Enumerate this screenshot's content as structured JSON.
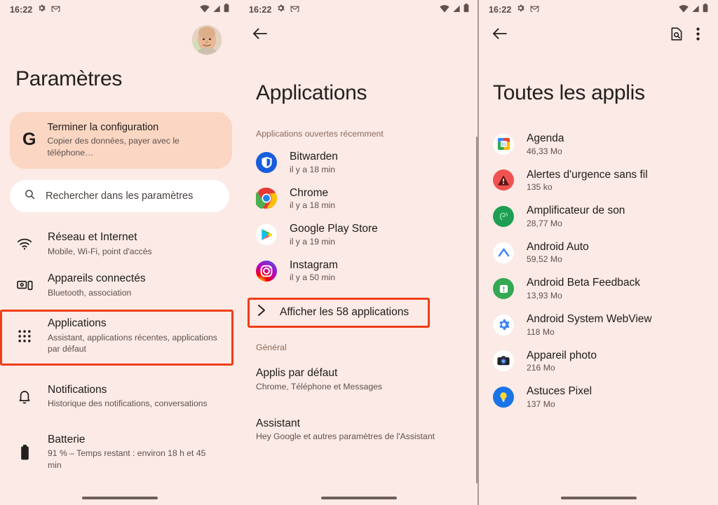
{
  "status_bar": {
    "time": "16:22",
    "left_icons": [
      "gear-icon",
      "gmail-icon"
    ],
    "right_icons": [
      "wifi-icon",
      "signal-icon",
      "battery-icon"
    ]
  },
  "colors": {
    "background": "#fbeae5",
    "setup_card": "#fbd6c2",
    "highlight": "#ef3e18",
    "text_primary": "#1e1b1a",
    "text_secondary": "#5d524f",
    "section_label": "#8c6a5d"
  },
  "screen1": {
    "title": "Paramètres",
    "avatar": "user-avatar",
    "setup_card": {
      "icon": "google-g-icon",
      "title": "Terminer la configuration",
      "subtitle": "Copier des données, payer avec le téléphone…"
    },
    "search": {
      "icon": "search-icon",
      "placeholder": "Rechercher dans les paramètres"
    },
    "items": [
      {
        "icon": "wifi-icon",
        "title": "Réseau et Internet",
        "subtitle": "Mobile, Wi-Fi, point d'accès",
        "highlighted": false
      },
      {
        "icon": "connected-devices-icon",
        "title": "Appareils connectés",
        "subtitle": "Bluetooth, association",
        "highlighted": false
      },
      {
        "icon": "apps-grid-icon",
        "title": "Applications",
        "subtitle": "Assistant, applications récentes, applications par défaut",
        "highlighted": true
      },
      {
        "icon": "bell-icon",
        "title": "Notifications",
        "subtitle": "Historique des notifications, conversations",
        "highlighted": false
      },
      {
        "icon": "battery-icon",
        "title": "Batterie",
        "subtitle": "91 % – Temps restant : environ 18 h et 45 min",
        "highlighted": false
      }
    ]
  },
  "screen2": {
    "back_icon": "back-arrow-icon",
    "title": "Applications",
    "recent_label": "Applications ouvertes récemment",
    "recent_apps": [
      {
        "icon": "bitwarden-icon",
        "name": "Bitwarden",
        "time": "il y a 18 min"
      },
      {
        "icon": "chrome-icon",
        "name": "Chrome",
        "time": "il y a 18 min"
      },
      {
        "icon": "play-store-icon",
        "name": "Google Play Store",
        "time": "il y a 19 min"
      },
      {
        "icon": "instagram-icon",
        "name": "Instagram",
        "time": "il y a 50 min"
      }
    ],
    "show_all": {
      "icon": "chevron-right-icon",
      "label": "Afficher les 58 applications",
      "highlighted": true
    },
    "general_label": "Général",
    "general_items": [
      {
        "title": "Applis par défaut",
        "subtitle": "Chrome, Téléphone et Messages"
      },
      {
        "title": "Assistant",
        "subtitle": "Hey Google et autres paramètres de l'Assistant"
      }
    ]
  },
  "screen3": {
    "back_icon": "back-arrow-icon",
    "search_apps_icon": "search-document-icon",
    "overflow_icon": "more-vertical-icon",
    "title": "Toutes les applis",
    "apps": [
      {
        "icon": "calendar-icon",
        "name": "Agenda",
        "size": "46,33 Mo"
      },
      {
        "icon": "emergency-alerts-icon",
        "name": "Alertes d'urgence sans fil",
        "size": "135 ko"
      },
      {
        "icon": "sound-amplifier-icon",
        "name": "Amplificateur de son",
        "size": "28,77 Mo"
      },
      {
        "icon": "android-auto-icon",
        "name": "Android Auto",
        "size": "59,52 Mo"
      },
      {
        "icon": "beta-feedback-icon",
        "name": "Android Beta Feedback",
        "size": "13,93 Mo"
      },
      {
        "icon": "webview-icon",
        "name": "Android System WebView",
        "size": "118 Mo"
      },
      {
        "icon": "camera-icon",
        "name": "Appareil photo",
        "size": "216 Mo"
      },
      {
        "icon": "pixel-tips-icon",
        "name": "Astuces Pixel",
        "size": "137 Mo"
      }
    ]
  }
}
